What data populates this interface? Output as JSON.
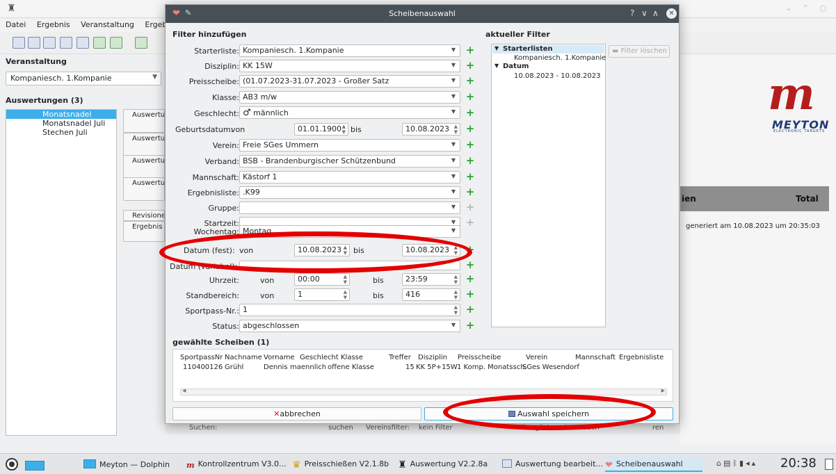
{
  "background": {
    "menu": [
      "Datei",
      "Ergebnis",
      "Veranstaltung",
      "Ergebnisliste"
    ],
    "veranstaltung_label": "Veranstaltung",
    "veranstaltung_value": "Kompaniesch. 1.Kompanie",
    "auswertungen_label": "Auswertungen (3)",
    "auswertungen": [
      "Monatsnadel August",
      "Monatsnadel Juli",
      "Stechen Juli"
    ],
    "side_buttons": [
      "Auswertung hinzufügen",
      "Auswertung bearbeiten",
      "Auswertung klonen",
      "Auswertung löschen"
    ],
    "revision_button": "Revisionen",
    "ergebnis_button": "Ergebnis übersicht",
    "logo_text": "MEYTON",
    "logo_sub": "ELECTRONIC TARGETS",
    "table_header_left": "ien",
    "table_header_total": "Total",
    "generated": "generiert am 10.08.2023 um 20:35:03",
    "search_label": "Suchen:",
    "search_button": "suchen",
    "vereinsfilter_label": "Vereinsfilter:",
    "vereinsfilter_value": "kein Filter",
    "rangliste": "Rangliste automatisch",
    "rangliste_tail": "ren"
  },
  "dialog": {
    "title": "Scheibenauswahl",
    "title_controls": [
      "?",
      "∨",
      "∧"
    ],
    "filter_group": "Filter hinzufügen",
    "fields": {
      "starterliste": {
        "label": "Starterliste:",
        "value": "Kompaniesch. 1.Kompanie"
      },
      "disziplin": {
        "label": "Disziplin:",
        "value": "KK 15W"
      },
      "preisscheibe": {
        "label": "Preisscheibe:",
        "value": "(01.07.2023-31.07.2023 - Großer Satz"
      },
      "klasse": {
        "label": "Klasse:",
        "value": "AB3 m/w"
      },
      "geschlecht": {
        "label": "Geschlecht:",
        "value": "männlich",
        "symbol": "♂"
      },
      "geburtsdatum": {
        "label": "Geburtsdatum:",
        "von": "von",
        "from": "01.01.1900",
        "bis": "bis",
        "to": "10.08.2023"
      },
      "verein": {
        "label": "Verein:",
        "value": "Freie SGes Ummern"
      },
      "verband": {
        "label": "Verband:",
        "value": "BSB - Brandenburgischer Schützenbund"
      },
      "mannschaft": {
        "label": "Mannschaft:",
        "value": "Kästorf 1"
      },
      "ergebnisliste": {
        "label": "Ergebnisliste:",
        "value": ".K99"
      },
      "gruppe": {
        "label": "Gruppe:",
        "value": ""
      },
      "startzeit": {
        "label": "Startzeit:",
        "value": ""
      },
      "wochentag": {
        "label": "Wochentag:",
        "value": "Montag"
      },
      "datum_fest": {
        "label": "Datum (fest):",
        "von": "von",
        "from": "10.08.2023",
        "bis": "bis",
        "to": "10.08.2023"
      },
      "datum_variabel": {
        "label": "Datum (variabel):",
        "value": ""
      },
      "uhrzeit": {
        "label": "Uhrzeit:",
        "von": "von",
        "from": "00:00",
        "bis": "bis",
        "to": "23:59"
      },
      "standbereich": {
        "label": "Standbereich:",
        "von": "von",
        "from": "1",
        "bis": "bis",
        "to": "416"
      },
      "sportpass": {
        "label": "Sportpass-Nr.:",
        "value": "1"
      },
      "status": {
        "label": "Status:",
        "value": "abgeschlossen"
      }
    },
    "current_filter_group": "aktueller Filter",
    "current_filter": [
      {
        "key": "Starterlisten",
        "value": "Kompaniesch. 1.Kompanie"
      },
      {
        "key": "Datum",
        "value": "10.08.2023 - 10.08.2023"
      }
    ],
    "filter_delete": "Filter löschen",
    "selected_group": "gewählte Scheiben (1)",
    "columns": [
      "SportpassNr",
      "Nachname",
      "Vorname",
      "Geschlecht",
      "Klasse",
      "Treffer",
      "Disziplin",
      "Preisscheibe",
      "Verein",
      "Mannschaft",
      "Ergebnisliste"
    ],
    "rows": [
      [
        "110400126",
        "Grühl",
        "Dennis",
        "maennlich",
        "offene Klasse",
        "15",
        "KK 5P+15W",
        "1 Komp. Monatssch.",
        "SGes Wesendorf",
        "",
        ""
      ]
    ],
    "cancel_button": "abbrechen",
    "save_button": "Auswahl speichern"
  },
  "taskbar": {
    "tasks": [
      {
        "label": "Meyton — Dolphin",
        "icon": "folder-icon"
      },
      {
        "label": "Kontrollzentrum V3.0...",
        "icon": "meyton-icon"
      },
      {
        "label": "Preisschießen V2.1.8b",
        "icon": "trophy-icon"
      },
      {
        "label": "Auswertung V2.2.8a",
        "icon": "chess-icon"
      },
      {
        "label": "Auswertung bearbeit...",
        "icon": "window-icon"
      },
      {
        "label": "Scheibenauswahl",
        "icon": "heart-icon"
      }
    ],
    "clock": "20:38"
  },
  "colors": {
    "accent": "#3daee9",
    "title_bar": "#475057",
    "highlight_ellipse": "#e30000",
    "plus": "#2ea02e"
  }
}
